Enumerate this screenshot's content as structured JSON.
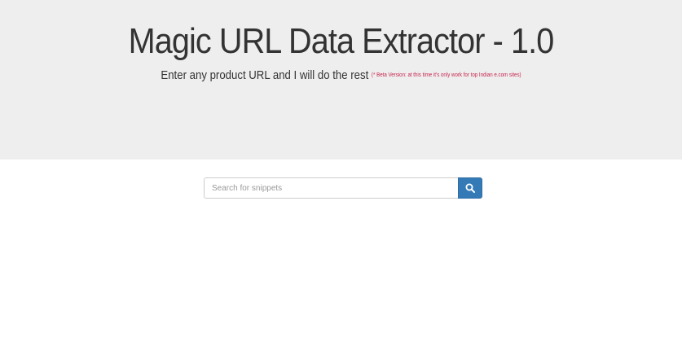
{
  "header": {
    "title": "Magic URL Data Extractor - 1.0",
    "subtitle": "Enter any product URL and I will do the rest",
    "beta_note": "(* Beta Version: at this time it's only work for top Indian e.com sites)"
  },
  "search": {
    "placeholder": "Search for snippets",
    "value": "",
    "button_icon": "search-icon"
  },
  "colors": {
    "hero_background": "#eeeeee",
    "button_primary": "#337ab7",
    "beta_note": "#c7254e"
  }
}
